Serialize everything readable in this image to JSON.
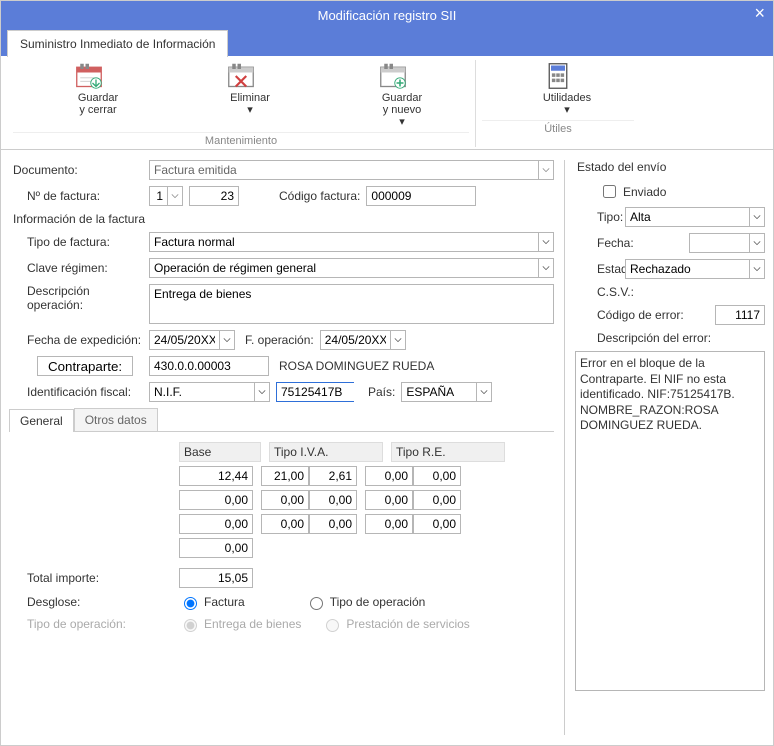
{
  "window": {
    "title": "Modificación registro SII",
    "close_icon": "×"
  },
  "tabstrip": {
    "tab": "Suministro Inmediato de Información"
  },
  "ribbon": {
    "group_mant": "Mantenimiento",
    "group_util": "Útiles",
    "save_close": "Guardar\ny cerrar",
    "delete": "Eliminar",
    "save_new": "Guardar\ny nuevo",
    "utilities": "Utilidades"
  },
  "form": {
    "documento_label": "Documento:",
    "documento_value": "Factura emitida",
    "n_factura_label": "Nº de factura:",
    "n_factura_series": "1",
    "n_factura_num": "23",
    "codigo_factura_label": "Código factura:",
    "codigo_factura_value": "000009",
    "section_info": "Información de la factura",
    "tipo_factura_label": "Tipo de factura:",
    "tipo_factura_value": "Factura normal",
    "clave_label": "Clave régimen:",
    "clave_value": "Operación de régimen general",
    "desc_label": "Descripción operación:",
    "desc_value": "Entrega de bienes",
    "fecha_exp_label": "Fecha de expedición:",
    "fecha_exp_value": "24/05/20XX",
    "fecha_op_label": "F. operación:",
    "fecha_op_value": "24/05/20XX",
    "contraparte_btn": "Contraparte:",
    "contraparte_code": "430.0.0.00003",
    "contraparte_name": "ROSA DOMINGUEZ RUEDA",
    "ident_label": "Identificación fiscal:",
    "ident_type": "N.I.F.",
    "ident_value": "75125417B",
    "pais_label": "País:",
    "pais_value": "ESPAÑA"
  },
  "subtabs": {
    "general": "General",
    "otros": "Otros datos"
  },
  "table": {
    "h_base": "Base",
    "h_iva": "Tipo I.V.A.",
    "h_re": "Tipo R.E.",
    "rows": [
      {
        "base": "12,44",
        "iva1": "21,00",
        "iva2": "2,61",
        "re1": "0,00",
        "re2": "0,00"
      },
      {
        "base": "0,00",
        "iva1": "0,00",
        "iva2": "0,00",
        "re1": "0,00",
        "re2": "0,00"
      },
      {
        "base": "0,00",
        "iva1": "0,00",
        "iva2": "0,00",
        "re1": "0,00",
        "re2": "0,00"
      }
    ],
    "extra_base": "0,00",
    "total_label": "Total importe:",
    "total_value": "15,05",
    "desglose_label": "Desglose:",
    "desglose_factura": "Factura",
    "desglose_tipo_op": "Tipo de operación",
    "tipo_op_label": "Tipo de operación:",
    "entrega": "Entrega de bienes",
    "prestacion": "Prestación de servicios"
  },
  "right": {
    "estado_envio": "Estado del envío",
    "enviado": "Enviado",
    "tipo_label": "Tipo:",
    "tipo_value": "Alta",
    "fecha_label": "Fecha:",
    "fecha_value": "",
    "estado_label": "Estado:",
    "estado_value": "Rechazado",
    "csv_label": "C.S.V.:",
    "cod_error_label": "Código de error:",
    "cod_error_value": "1117",
    "desc_error_label": "Descripción del error:",
    "desc_error_value": "Error en el bloque de la Contraparte. El NIF no esta identificado. NIF:75125417B. NOMBRE_RAZON:ROSA DOMINGUEZ RUEDA."
  }
}
